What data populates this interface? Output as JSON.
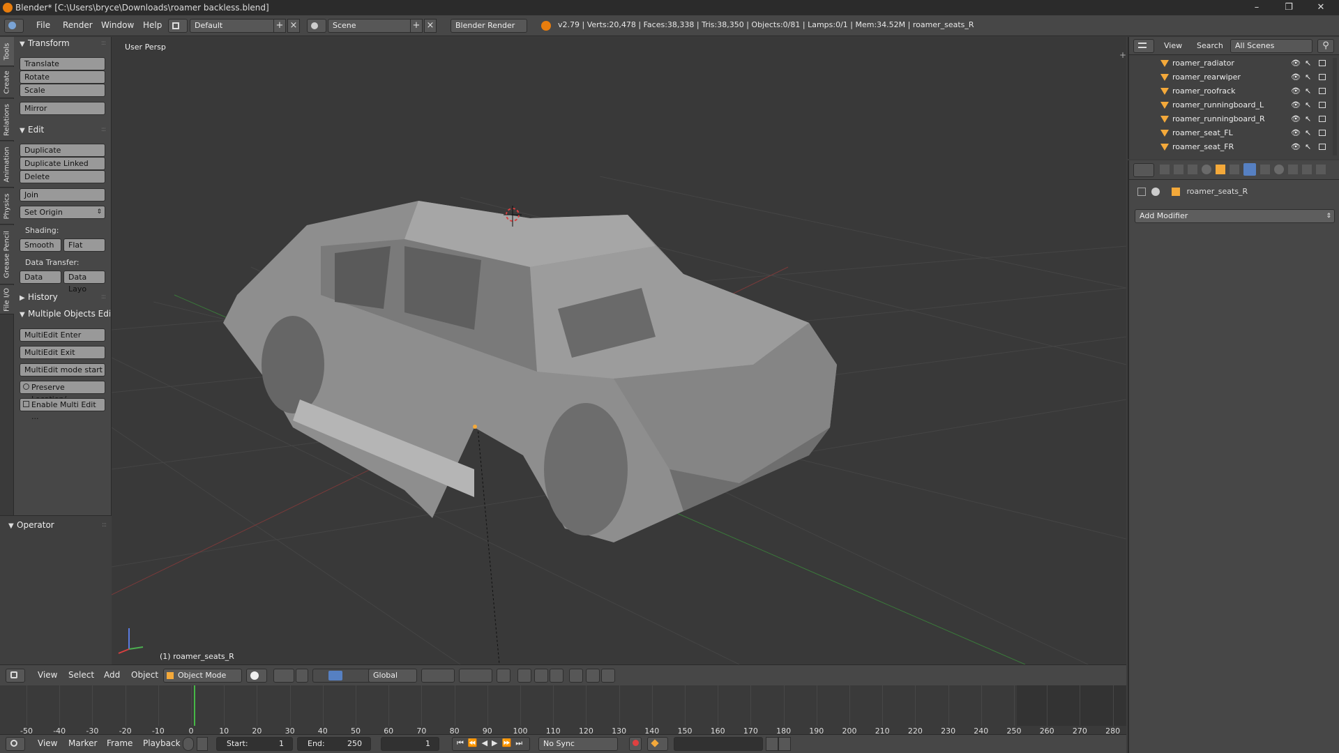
{
  "titlebar": {
    "title": "Blender* [C:\\Users\\bryce\\Downloads\\roamer backless.blend]",
    "minimize": "–",
    "maximize": "❐",
    "close": "✕"
  },
  "infobar": {
    "menus": [
      "File",
      "Render",
      "Window",
      "Help"
    ],
    "screen_layout": "Default",
    "scene": "Scene",
    "render_engine": "Blender Render",
    "stats": "v2.79 | Verts:20,478 | Faces:38,338 | Tris:38,350 | Objects:0/81 | Lamps:0/1 | Mem:34.52M | roamer_seats_R"
  },
  "tabs": [
    "Tools",
    "Create",
    "Relations",
    "Animation",
    "Physics",
    "Grease Pencil",
    "File I/O"
  ],
  "toolshelf": {
    "transform": {
      "header": "Transform",
      "buttons": [
        "Translate",
        "Rotate",
        "Scale",
        "Mirror"
      ]
    },
    "edit": {
      "header": "Edit",
      "buttons": [
        "Duplicate",
        "Duplicate Linked",
        "Delete",
        "Join"
      ],
      "set_origin": "Set Origin",
      "shading_label": "Shading:",
      "smooth": "Smooth",
      "flat": "Flat",
      "data_transfer_label": "Data Transfer:",
      "data": "Data",
      "data_layout": "Data Layo"
    },
    "history": {
      "header": "History"
    },
    "multiple_objects": {
      "header": "Multiple Objects Edit",
      "buttons": [
        "MultiEdit Enter",
        "MultiEdit Exit",
        "MultiEdit mode start",
        "Preserve Location/...",
        "Enable Multi Edit ..."
      ]
    },
    "operator": {
      "header": "Operator"
    }
  },
  "viewport": {
    "view_label": "User Persp",
    "object_label": "(1) roamer_seats_R"
  },
  "vpheader": {
    "menus": [
      "View",
      "Select",
      "Add",
      "Object"
    ],
    "mode": "Object Mode",
    "orientation": "Global"
  },
  "timeline": {
    "ticks": [
      -50,
      -40,
      -30,
      -20,
      -10,
      0,
      10,
      20,
      30,
      40,
      50,
      60,
      70,
      80,
      90,
      100,
      110,
      120,
      130,
      140,
      150,
      160,
      170,
      180,
      190,
      200,
      210,
      220,
      230,
      240,
      250,
      260,
      270,
      280
    ],
    "current_frame": 1,
    "menus": [
      "View",
      "Marker",
      "Frame",
      "Playback"
    ],
    "start_label": "Start:",
    "start": "1",
    "end_label": "End:",
    "end": "250",
    "frame": "1",
    "sync": "No Sync"
  },
  "outliner": {
    "menus": [
      "View",
      "Search"
    ],
    "scenes": "All Scenes",
    "items": [
      "roamer_radiator",
      "roamer_rearwiper",
      "roamer_roofrack",
      "roamer_runningboard_L",
      "roamer_runningboard_R",
      "roamer_seat_FL",
      "roamer_seat_FR"
    ]
  },
  "properties": {
    "object_name": "roamer_seats_R",
    "add_modifier": "Add Modifier"
  }
}
